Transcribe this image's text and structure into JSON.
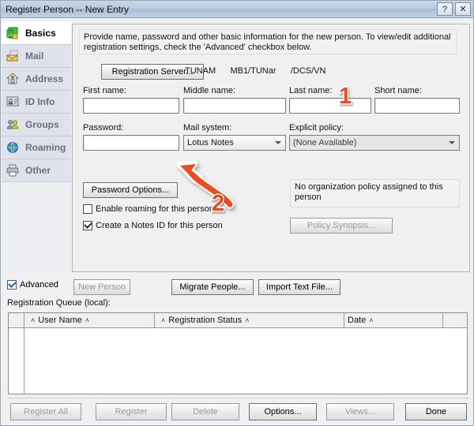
{
  "window": {
    "title": "Register Person -- New Entry",
    "help_button": "?",
    "close_button": "✕"
  },
  "sidebar": {
    "items": [
      {
        "label": "Basics",
        "icon": "basics-icon",
        "selected": true
      },
      {
        "label": "Mail",
        "icon": "mail-icon",
        "selected": false
      },
      {
        "label": "Address",
        "icon": "address-icon",
        "selected": false
      },
      {
        "label": "ID Info",
        "icon": "id-info-icon",
        "selected": false
      },
      {
        "label": "Groups",
        "icon": "groups-icon",
        "selected": false
      },
      {
        "label": "Roaming",
        "icon": "roaming-icon",
        "selected": false
      },
      {
        "label": "Other",
        "icon": "other-icon",
        "selected": false
      }
    ]
  },
  "main": {
    "info_text": "Provide name, password and other basic information for the new person.  To view/edit additional registration settings, check the 'Advanced' checkbox below.",
    "registration_server_button": "Registration Server...",
    "registration_server_value": "TUNAM      MB1/TUNar      /DCS/VN",
    "fields": {
      "first_name_label": "First name:",
      "first_name_value": "",
      "middle_name_label": "Middle name:",
      "middle_name_value": "",
      "last_name_label": "Last name:",
      "last_name_value": "",
      "short_name_label": "Short name:",
      "short_name_value": "",
      "password_label": "Password:",
      "password_value": "",
      "mail_system_label": "Mail system:",
      "mail_system_value": "Lotus Notes",
      "explicit_policy_label": "Explicit policy:",
      "explicit_policy_value": "(None Available)"
    },
    "password_options_button": "Password Options...",
    "enable_roaming_label": "Enable roaming for this person",
    "enable_roaming_checked": false,
    "create_notes_id_label": "Create a Notes ID for this person",
    "create_notes_id_checked": true,
    "policy_message": "No organization policy assigned to this person",
    "policy_synopsis_button": "Policy Synopsis..."
  },
  "toolbar": {
    "advanced_label": "Advanced",
    "advanced_checked": true,
    "new_person_button": "New Person",
    "migrate_people_button": "Migrate People...",
    "import_text_file_button": "Import Text File...",
    "queue_label": "Registration Queue (local):"
  },
  "table": {
    "columns": [
      {
        "label": "",
        "sort": ""
      },
      {
        "label": "User Name",
        "sort": "˄"
      },
      {
        "label": "Registration Status",
        "sort": "˄"
      },
      {
        "label": "Date",
        "sort": "˄"
      },
      {
        "label": "",
        "sort": ""
      }
    ],
    "rows": []
  },
  "footer": {
    "register_all_button": "Register All",
    "register_button": "Register",
    "delete_button": "Delete",
    "options_button": "Options...",
    "views_button": "Views...",
    "done_button": "Done"
  },
  "annotations": [
    {
      "id": "step-1",
      "label": "1",
      "target": "last-name-field"
    },
    {
      "id": "step-2",
      "label": "2",
      "target": "password-options-button"
    }
  ],
  "colors": {
    "accent": "#f04a16",
    "titlebar": "#bccde0",
    "window_bg": "#f0f0f0"
  }
}
